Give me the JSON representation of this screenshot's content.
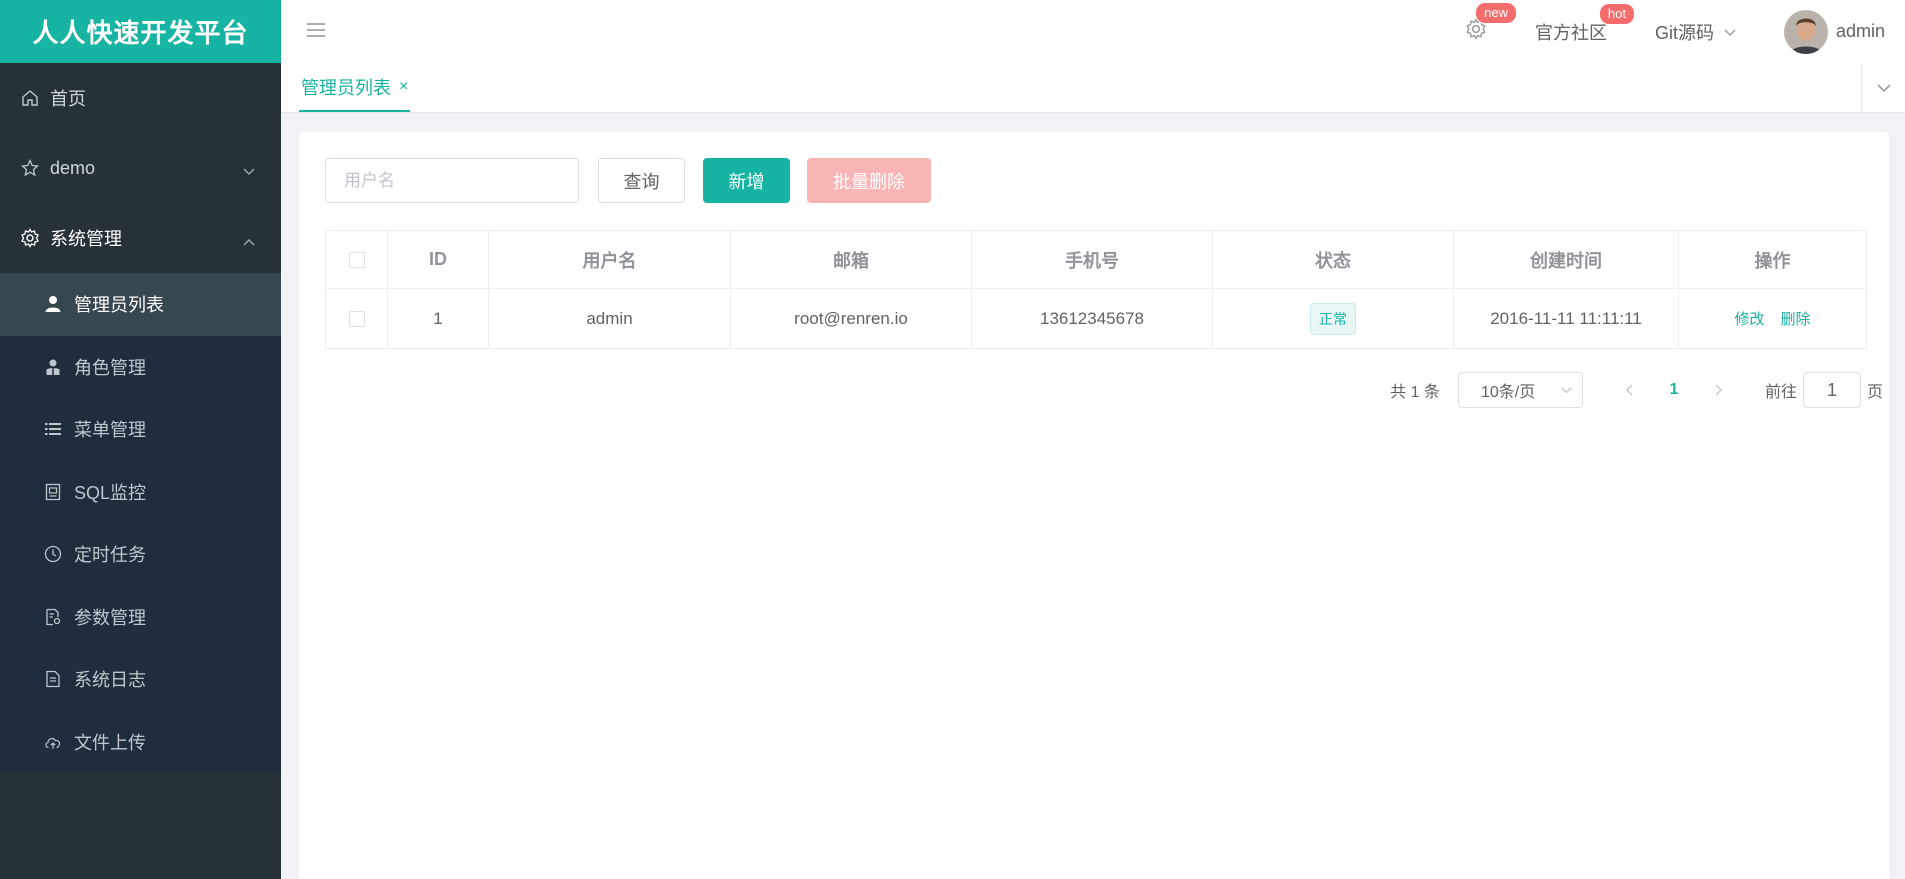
{
  "brand": "人人快速开发平台",
  "sidebar": {
    "items": [
      {
        "label": "首页",
        "icon": "home-icon"
      },
      {
        "label": "demo",
        "icon": "star-icon"
      },
      {
        "label": "系统管理",
        "icon": "gear-icon"
      }
    ],
    "subitems": [
      {
        "label": "管理员列表",
        "icon": "user-icon",
        "active": true
      },
      {
        "label": "角色管理",
        "icon": "role-icon"
      },
      {
        "label": "菜单管理",
        "icon": "list-icon"
      },
      {
        "label": "SQL监控",
        "icon": "sql-icon"
      },
      {
        "label": "定时任务",
        "icon": "clock-icon"
      },
      {
        "label": "参数管理",
        "icon": "params-icon"
      },
      {
        "label": "系统日志",
        "icon": "log-icon"
      },
      {
        "label": "文件上传",
        "icon": "upload-icon"
      }
    ]
  },
  "navbar": {
    "badge_new": "new",
    "community": "官方社区",
    "badge_hot": "hot",
    "git": "Git源码",
    "user": "admin"
  },
  "tabs": [
    {
      "label": "管理员列表",
      "close": "×"
    }
  ],
  "toolbar": {
    "search_placeholder": "用户名",
    "query": "查询",
    "add": "新增",
    "batch_delete": "批量删除"
  },
  "table": {
    "headers": [
      "ID",
      "用户名",
      "邮箱",
      "手机号",
      "状态",
      "创建时间",
      "操作"
    ],
    "rows": [
      {
        "id": "1",
        "username": "admin",
        "email": "root@renren.io",
        "mobile": "13612345678",
        "status": "正常",
        "created": "2016-11-11 11:11:11",
        "edit": "修改",
        "delete": "删除"
      }
    ]
  },
  "pagination": {
    "total": "共 1 条",
    "page_size": "10条/页",
    "current": "1",
    "goto_prefix": "前往",
    "goto_value": "1",
    "goto_suffix": "页"
  },
  "colors": {
    "accent": "#17b3a3",
    "sidebar": "#263238",
    "danger_light": "#f9b5b5",
    "badge": "#f56c6c"
  }
}
